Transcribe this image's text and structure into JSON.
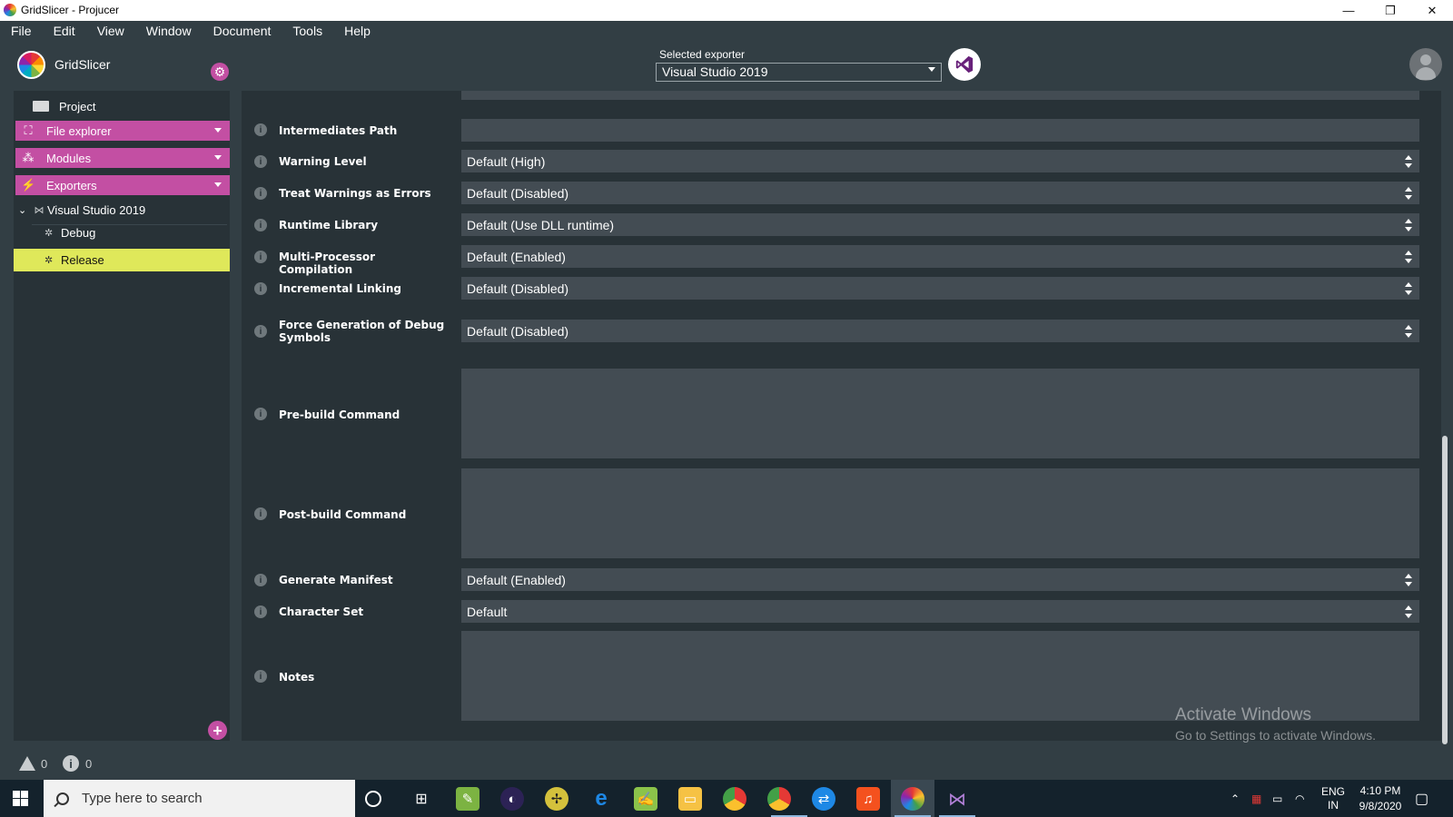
{
  "window": {
    "title": "GridSlicer - Projucer",
    "minimize": "—",
    "restore": "❐",
    "close": "✕"
  },
  "menu": [
    "File",
    "Edit",
    "View",
    "Window",
    "Document",
    "Tools",
    "Help"
  ],
  "header": {
    "project_name": "GridSlicer",
    "selected_exporter_label": "Selected exporter",
    "selected_exporter_value": "Visual Studio 2019"
  },
  "sidebar": {
    "project_label": "Project",
    "sections": [
      {
        "label": "File explorer",
        "icon": "hierarchy-icon"
      },
      {
        "label": "Modules",
        "icon": "modules-icon"
      },
      {
        "label": "Exporters",
        "icon": "exporters-icon"
      }
    ],
    "exporter": "Visual Studio 2019",
    "configs": [
      "Debug",
      "Release"
    ],
    "selected_config": "Release"
  },
  "properties": [
    {
      "label": "Intermediates Path",
      "value": "",
      "type": "text"
    },
    {
      "label": "Warning Level",
      "value": "Default (High)",
      "type": "choice"
    },
    {
      "label": "Treat Warnings as Errors",
      "value": "Default (Disabled)",
      "type": "choice"
    },
    {
      "label": "Runtime Library",
      "value": "Default (Use DLL runtime)",
      "type": "choice"
    },
    {
      "label": "Multi-Processor Compilation",
      "value": "Default (Enabled)",
      "type": "choice"
    },
    {
      "label": "Incremental Linking",
      "value": "Default (Disabled)",
      "type": "choice"
    },
    {
      "label": "Force Generation of Debug Symbols",
      "value": "Default (Disabled)",
      "type": "choice"
    },
    {
      "label": "Pre-build Command",
      "value": "",
      "type": "textarea"
    },
    {
      "label": "Post-build Command",
      "value": "",
      "type": "textarea"
    },
    {
      "label": "Generate Manifest",
      "value": "Default (Enabled)",
      "type": "choice"
    },
    {
      "label": "Character Set",
      "value": "Default",
      "type": "choice"
    },
    {
      "label": "Notes",
      "value": "",
      "type": "textarea"
    }
  ],
  "watermark": {
    "line1": "Activate Windows",
    "line2": "Go to Settings to activate Windows."
  },
  "status": {
    "warnings": "0",
    "infos": "0"
  },
  "taskbar": {
    "search_placeholder": "Type here to search",
    "lang": "ENG",
    "region": "IN",
    "time": "4:10 PM",
    "date": "9/8/2020"
  },
  "colors": {
    "accent": "#c34fa3",
    "selected": "#dfe85a",
    "background": "#323e44",
    "panel": "#283237",
    "field": "#434c53"
  }
}
